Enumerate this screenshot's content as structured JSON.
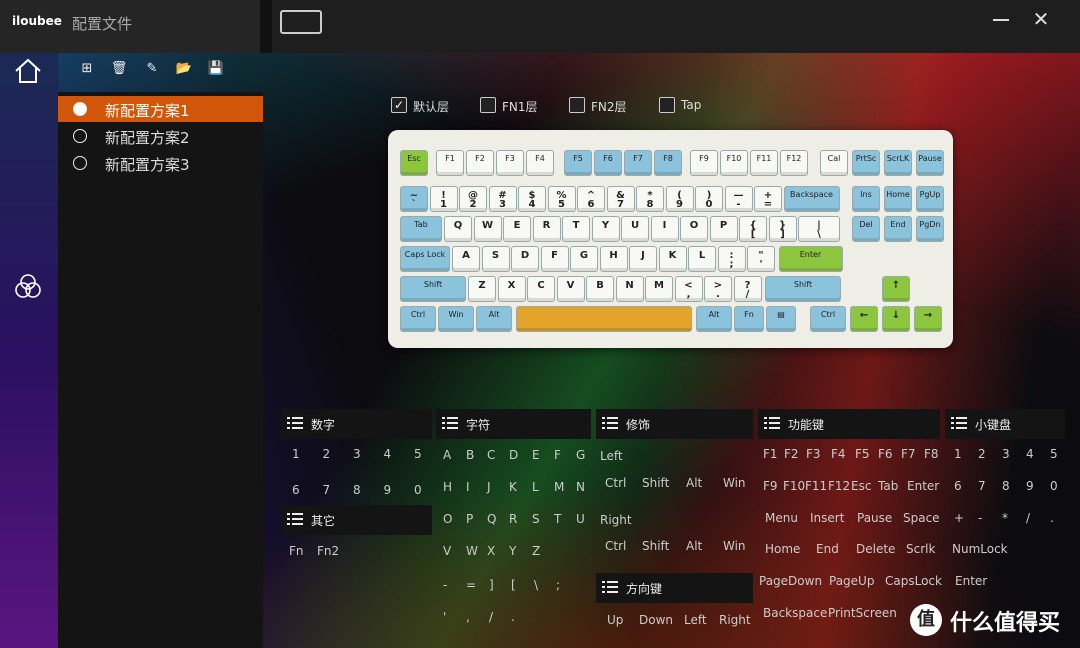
{
  "app": {
    "brand": "iloubee",
    "title": "配置文件"
  },
  "window": {
    "close": "✕"
  },
  "profiles": [
    {
      "label": "新配置方案1",
      "active": true
    },
    {
      "label": "新配置方案2",
      "active": false
    },
    {
      "label": "新配置方案3",
      "active": false
    }
  ],
  "toolbar": {
    "new": "⊞",
    "delete": "🗑",
    "edit": "✎",
    "open": "📂",
    "save": "💾"
  },
  "layers": [
    {
      "label": "默认层",
      "checked": true,
      "mark": "✓"
    },
    {
      "label": "FN1层",
      "checked": false,
      "mark": ""
    },
    {
      "label": "FN2层",
      "checked": false,
      "mark": ""
    },
    {
      "label": "Tap",
      "checked": false,
      "mark": ""
    }
  ],
  "keyboard": {
    "fn_row": [
      "Esc",
      "F1",
      "F2",
      "F3",
      "F4",
      "F5",
      "F6",
      "F7",
      "F8",
      "F9",
      "F10",
      "F11",
      "F12",
      "Cal",
      "PrtSc",
      "ScrLK",
      "Pause"
    ],
    "num_row": [
      "~\n`",
      "!\n1",
      "@\n2",
      "#\n3",
      "$\n4",
      "%\n5",
      "^\n6",
      "&\n7",
      "*\n8",
      "(\n9",
      ")\n0",
      "—\n-",
      "+\n=",
      "Backspace",
      "Ins",
      "Home",
      "PgUp"
    ],
    "tab_row": [
      "Tab",
      "Q",
      "W",
      "E",
      "R",
      "T",
      "Y",
      "U",
      "I",
      "O",
      "P",
      "{\n[",
      "}\n]",
      "|\n\\",
      "Del",
      "End",
      "PgDn"
    ],
    "caps_row": [
      "Caps Lock",
      "A",
      "S",
      "D",
      "F",
      "G",
      "H",
      "J",
      "K",
      "L",
      ":\n;",
      "\"\n'",
      "Enter"
    ],
    "shift_row": [
      "Shift",
      "Z",
      "X",
      "C",
      "V",
      "B",
      "N",
      "M",
      "<\n,",
      ">\n.",
      "?\n/",
      "Shift",
      "↑"
    ],
    "ctrl_row": [
      "Ctrl",
      "Win",
      "Alt",
      "",
      "Alt",
      "Fn",
      "▤",
      "Ctrl",
      "←",
      "↓",
      "→"
    ]
  },
  "groups": {
    "numbers": {
      "title": "数字",
      "items": [
        "1",
        "2",
        "3",
        "4",
        "5",
        "6",
        "7",
        "8",
        "9",
        "0"
      ]
    },
    "chars": {
      "title": "字符",
      "items": [
        "A",
        "B",
        "C",
        "D",
        "E",
        "F",
        "G",
        "H",
        "I",
        "J",
        "K",
        "L",
        "M",
        "N",
        "O",
        "P",
        "Q",
        "R",
        "S",
        "T",
        "U",
        "V",
        "W",
        "X",
        "Y",
        "Z",
        "-",
        "=",
        "]",
        "[",
        "\\",
        ";",
        "'",
        ",",
        "/",
        "."
      ]
    },
    "modifiers": {
      "title": "修饰",
      "left": "Left",
      "right": "Right",
      "items": [
        "Ctrl",
        "Shift",
        "Alt",
        "Win"
      ]
    },
    "function": {
      "title": "功能键",
      "row1": [
        "F1",
        "F2",
        "F3",
        "F4",
        "F5",
        "F6",
        "F7",
        "F8"
      ],
      "row2": [
        "F9",
        "F10",
        "F11",
        "F12",
        "Esc",
        "Tab",
        "Enter"
      ],
      "row3": [
        "Menu",
        "Insert",
        "Pause",
        "Space"
      ],
      "row4": [
        "Home",
        "End",
        "Delete",
        "Scrlk",
        "NumLock"
      ],
      "row5": [
        "PageDown",
        "PageUp",
        "CapsLock",
        "Enter"
      ],
      "row6": [
        "Backspace",
        "PrintScreen"
      ]
    },
    "numpad": {
      "title": "小键盘",
      "items": [
        "1",
        "2",
        "3",
        "4",
        "5",
        "6",
        "7",
        "8",
        "9",
        "0",
        "+",
        "-",
        "*",
        "/",
        "."
      ]
    },
    "other": {
      "title": "其它",
      "items": [
        "Fn",
        "Fn2"
      ]
    },
    "arrows": {
      "title": "方向键",
      "items": [
        "Up",
        "Down",
        "Left",
        "Right"
      ]
    }
  },
  "watermark": {
    "logo": "值",
    "text": "什么值得买"
  }
}
